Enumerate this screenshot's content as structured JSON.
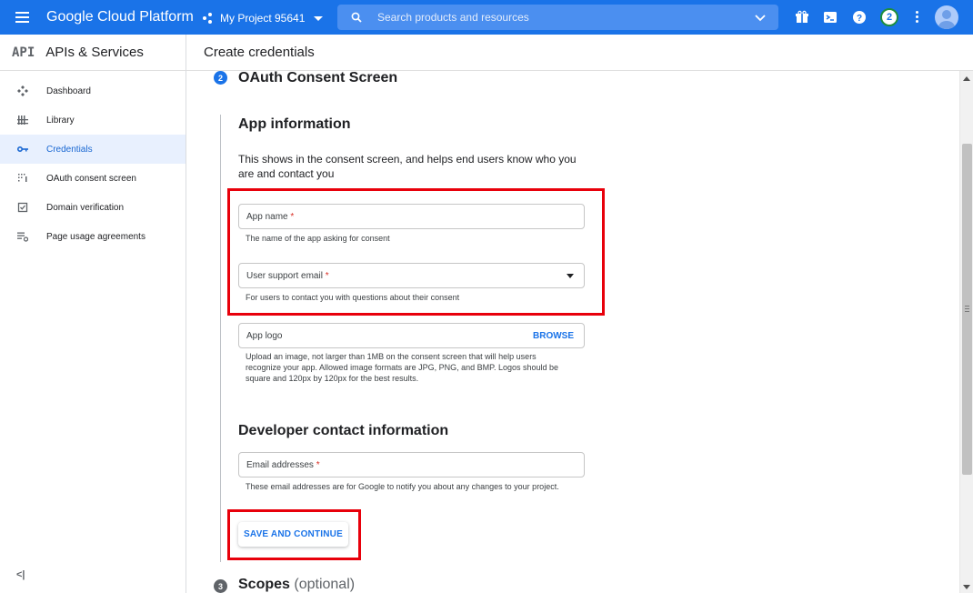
{
  "header": {
    "brand": "Google Cloud Platform",
    "project_name": "My Project 95641",
    "search_placeholder": "Search products and resources",
    "notification_count": "2"
  },
  "sidebar": {
    "logo_text": "API",
    "title": "APIs & Services",
    "items": [
      {
        "label": "Dashboard",
        "icon": "dashboard-icon"
      },
      {
        "label": "Library",
        "icon": "library-icon"
      },
      {
        "label": "Credentials",
        "icon": "key-icon",
        "active": true
      },
      {
        "label": "OAuth consent screen",
        "icon": "consent-icon"
      },
      {
        "label": "Domain verification",
        "icon": "checkbox-icon"
      },
      {
        "label": "Page usage agreements",
        "icon": "settings-list-icon"
      }
    ],
    "collapse_label": "<|"
  },
  "page": {
    "title": "Create credentials"
  },
  "step2": {
    "number": "2",
    "title": "OAuth Consent Screen"
  },
  "app_info": {
    "title": "App information",
    "description": "This shows in the consent screen, and helps end users know who you are and contact you",
    "app_name": {
      "label": "App name",
      "required_mark": "*",
      "value": "",
      "help": "The name of the app asking for consent"
    },
    "support_email": {
      "label": "User support email",
      "required_mark": "*",
      "value": "",
      "help": "For users to contact you with questions about their consent"
    },
    "app_logo": {
      "label": "App logo",
      "browse_label": "BROWSE",
      "help": "Upload an image, not larger than 1MB on the consent screen that will help users recognize your app. Allowed image formats are JPG, PNG, and BMP. Logos should be square and 120px by 120px for the best results."
    }
  },
  "developer_contact": {
    "title": "Developer contact information",
    "email": {
      "label": "Email addresses",
      "required_mark": "*",
      "value": "",
      "help": "These email addresses are for Google to notify you about any changes to your project."
    }
  },
  "actions": {
    "save_continue": "SAVE AND CONTINUE"
  },
  "step3": {
    "number": "3",
    "title": "Scopes",
    "optional": "(optional)"
  },
  "colors": {
    "brand_blue": "#1a73e8",
    "highlight_red": "#e8000b",
    "active_bg": "#e8f0fe",
    "step_active": "#1a73e8",
    "step_inactive": "#5f6368"
  }
}
